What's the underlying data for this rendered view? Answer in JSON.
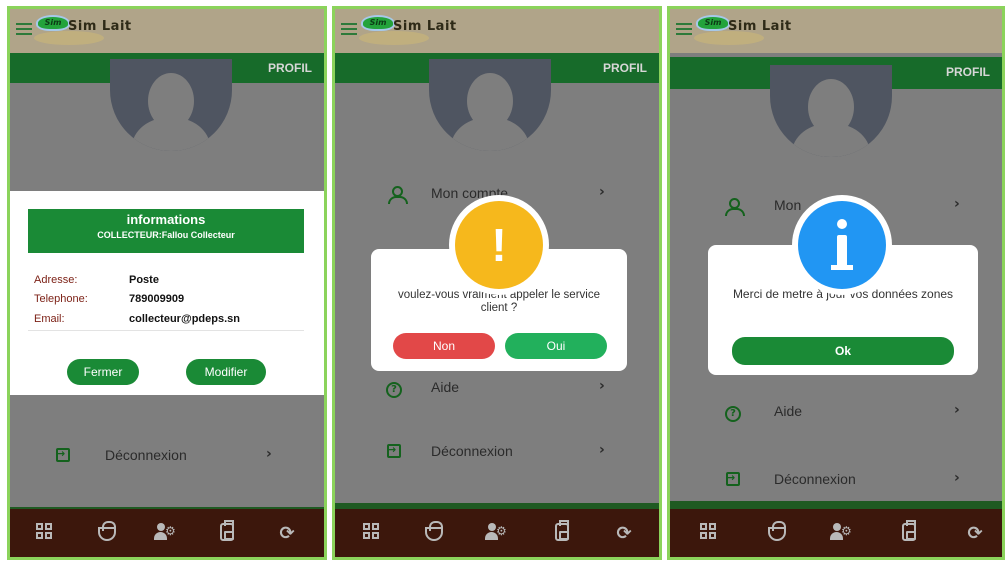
{
  "app": {
    "title": "Sim Lait",
    "logo_text": "Sim"
  },
  "header": {
    "section": "PROFIL"
  },
  "menu": {
    "account": "Mon compte",
    "account_partial": "Mon",
    "help": "Aide",
    "logout": "Déconnexion",
    "chevron": "›"
  },
  "screen1": {
    "modal": {
      "title": "informations",
      "subtitle": "COLLECTEUR:Fallou Collecteur",
      "fields": [
        {
          "label": "Adresse:",
          "value": "Poste"
        },
        {
          "label": "Telephone:",
          "value": "789009909"
        },
        {
          "label": "Email:",
          "value": "collecteur@pdeps.sn"
        }
      ],
      "close": "Fermer",
      "edit": "Modifier"
    }
  },
  "screen2": {
    "modal": {
      "icon": "!",
      "message": "voulez-vous vraiment appeler le service client ?",
      "no": "Non",
      "yes": "Oui"
    }
  },
  "screen3": {
    "modal": {
      "message": "Merci de metre à jour vos données zones",
      "ok": "Ok"
    }
  },
  "bottom_nav": [
    "dashboard-icon",
    "basket-icon",
    "users-settings-icon",
    "milk-can-icon",
    "sync-icon"
  ],
  "colors": {
    "brand_green": "#176b2a",
    "button_green": "#1a8a36",
    "warning": "#f6b81c",
    "info": "#2196f3",
    "danger": "#e24848",
    "bottom_bar": "#3c170c"
  }
}
